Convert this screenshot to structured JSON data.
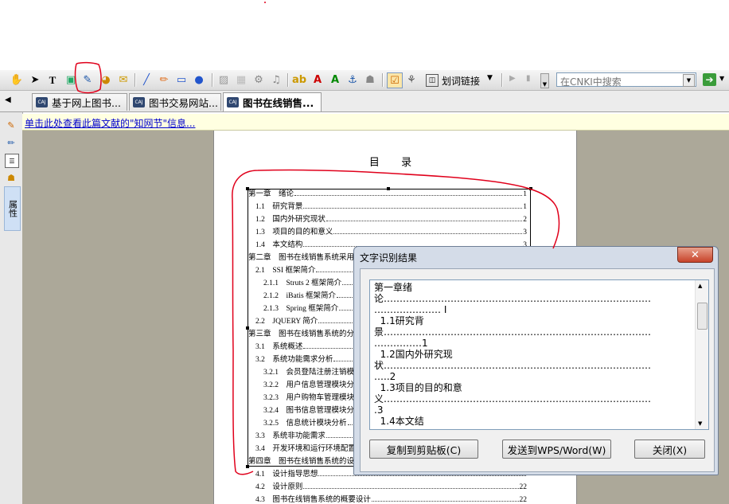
{
  "toolbar": {
    "link_button_label": "划词链接",
    "search_placeholder": "在CNKI中搜索",
    "icons": [
      "hand-tool",
      "select-arrow",
      "text-select",
      "snapshot",
      "ocr-text-recognition",
      "highlight",
      "note",
      "pen",
      "pencil",
      "rectangle",
      "ellipse",
      "eraser",
      "image",
      "settings",
      "audio",
      "highlight-text",
      "strikeout",
      "underline",
      "anchor",
      "stamp",
      "properties",
      "tools"
    ]
  },
  "tabs": [
    {
      "label": "基于网上图书..."
    },
    {
      "label": "图书交易网站..."
    },
    {
      "label": "图书在线销售..."
    }
  ],
  "sidebar": {
    "panel_label": "属性"
  },
  "infobar": {
    "link_text": "单击此处查看此篇文献的\"知网节\"信息..."
  },
  "document": {
    "toc_title": "目  录",
    "toc": [
      {
        "text": "第一章　绪论",
        "page": "1",
        "level": 0
      },
      {
        "text": "1.1　研究背景",
        "page": "1",
        "level": 1
      },
      {
        "text": "1.2　国内外研究现状",
        "page": "2",
        "level": 1
      },
      {
        "text": "1.3　项目的目的和意义",
        "page": "3",
        "level": 1
      },
      {
        "text": "1.4　本文结构",
        "page": "3",
        "level": 1
      },
      {
        "text": "第二章　图书在线销售系统采用",
        "page": "",
        "level": 0
      },
      {
        "text": "2.1　SSI 框架简介",
        "page": "",
        "level": 1
      },
      {
        "text": "2.1.1　Struts 2 框架简介",
        "page": "",
        "level": 2
      },
      {
        "text": "2.1.2　iBatis 框架简介",
        "page": "",
        "level": 2
      },
      {
        "text": "2.1.3　Spring 框架简介",
        "page": "",
        "level": 2
      },
      {
        "text": "2.2　JQUERY 简介",
        "page": "",
        "level": 1
      },
      {
        "text": "第三章　图书在线销售系统的分",
        "page": "",
        "level": 0
      },
      {
        "text": "3.1　系统概述",
        "page": "",
        "level": 1
      },
      {
        "text": "3.2　系统功能需求分析",
        "page": "",
        "level": 1
      },
      {
        "text": "3.2.1　会员登陆注册注销模",
        "page": "",
        "level": 2
      },
      {
        "text": "3.2.2　用户信息管理模块分",
        "page": "",
        "level": 2
      },
      {
        "text": "3.2.3　用户购物车管理模块",
        "page": "",
        "level": 2
      },
      {
        "text": "3.2.4　图书信息管理模块分",
        "page": "",
        "level": 2
      },
      {
        "text": "3.2.5　信息统计模块分析",
        "page": "",
        "level": 2
      },
      {
        "text": "3.3　系统非功能需求",
        "page": "",
        "level": 1
      },
      {
        "text": "3.4　开发环境和运行环境配置",
        "page": "",
        "level": 1
      },
      {
        "text": "第四章　图书在线销售系统的设",
        "page": "",
        "level": 0
      },
      {
        "text": "4.1　设计指导思想",
        "page": "",
        "level": 1
      },
      {
        "text": "4.2　设计原则",
        "page": "22",
        "level": 1
      },
      {
        "text": "4.3　图书在线销售系统的概要设计",
        "page": "22",
        "level": 1
      }
    ]
  },
  "dialog": {
    "title": "文字识别结果",
    "close_glyph": "✕",
    "content_lines": [
      "第一章绪",
      "论…………………………………………………………………………",
      "………………… I",
      "  1.1研究背",
      "景…………………………………………………………………………",
      "……………1",
      "  1.2国内外研究现",
      "状…………………………………………………………………………",
      "…..2",
      "  1.3项目的目的和意",
      "义…………………………………………………………………………",
      ".3",
      "  1.4本文结"
    ],
    "buttons": {
      "copy": "复制到剪贴板(C)",
      "send": "发送到WPS/Word(W)",
      "close": "关闭(X)"
    }
  },
  "colors": {
    "annotation_red": "#e0001b",
    "infobar_bg": "#ffffe1",
    "viewer_bg": "#aca899"
  }
}
